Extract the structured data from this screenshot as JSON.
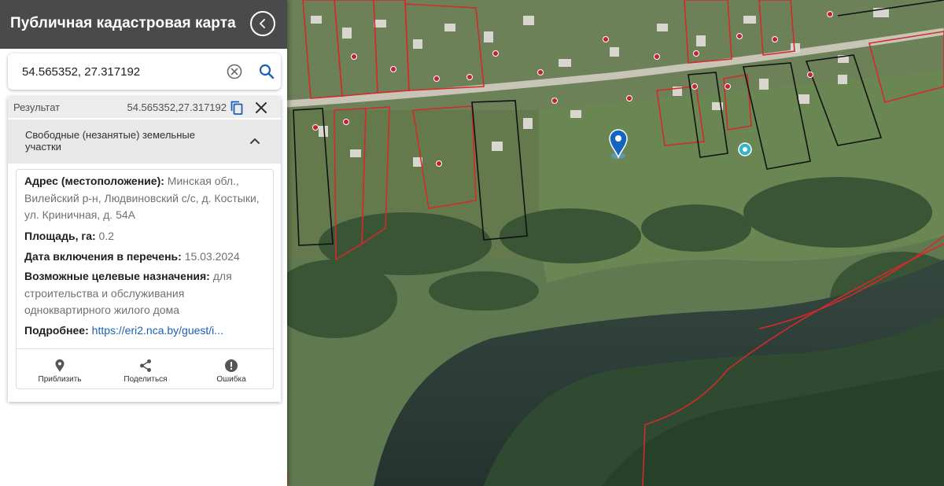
{
  "app": {
    "title": "Публичная кадастровая карта"
  },
  "search": {
    "value": "54.565352, 27.317192"
  },
  "result": {
    "label": "Результат",
    "coords": "54.565352,27.317192",
    "category": "Свободные (незанятые) земельные участки",
    "fields": {
      "address_key": "Адрес (местоположение):",
      "address_value": "Минская обл., Вилейский р-н, Людвиновский с/с, д. Костыки, ул. Криничная, д. 54А",
      "area_key": "Площадь, га:",
      "area_value": "0.2",
      "date_key": "Дата включения в перечень:",
      "date_value": "15.03.2024",
      "purpose_key": "Возможные целевые назначения:",
      "purpose_value": "для строительства и обслуживания одноквартирного жилого дома",
      "more_key": "Подробнее:",
      "more_value": "https://eri2.nca.by/guest/i..."
    },
    "actions": {
      "zoom": "Приблизить",
      "share": "Поделиться",
      "error": "Ошибка"
    }
  },
  "icons": {
    "collapse": "chevron-left-icon",
    "clear": "clear-circle-icon",
    "search": "search-icon",
    "copy": "copy-icon",
    "close": "close-icon",
    "expand": "chevron-up-icon",
    "zoom": "location-pin-icon",
    "share": "share-icon",
    "error": "error-icon",
    "map_marker": "map-pin-icon"
  },
  "colors": {
    "header_bg": "#4a4a4a",
    "accent": "#1a5fb4",
    "parcel_red": "#d42a2a",
    "parcel_black": "#111111",
    "water": "#2b3d39"
  }
}
